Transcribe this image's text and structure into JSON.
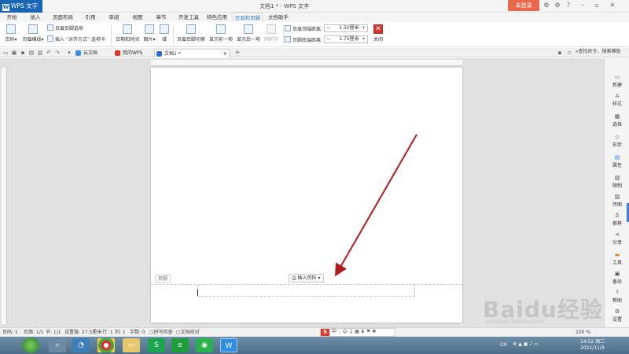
{
  "app": {
    "name": "WPS 文字",
    "doc_title": "文档1 * - WPS 文字",
    "login": "未登录"
  },
  "menu_tabs": [
    "开始",
    "插入",
    "页面布局",
    "引用",
    "审阅",
    "视图",
    "章节",
    "开发工具",
    "特色应用",
    "页眉和页脚",
    "文档助手"
  ],
  "active_menu_tab": 9,
  "ribbon": {
    "page_num": "页码",
    "header_line": "页眉横线",
    "hf_options": "页眉页脚选项",
    "insert_align_tab": "插入 “对齐方式” 选项卡",
    "date_time": "日期和时间",
    "picture": "图片",
    "field": "域",
    "hf_switch": "页眉页脚切换",
    "show_prev": "显示前一项",
    "show_next": "显示后一项",
    "same_prev": "同前节",
    "header_top_label": "页眉顶端距离:",
    "header_top_value": "1.50厘米",
    "footer_bottom_label": "页脚底端距离:",
    "footer_bottom_value": "1.75厘米",
    "close": "关闭",
    "minus": "−",
    "plus": "+"
  },
  "doc_tabs": [
    "云文档",
    "我的WPS",
    "文档1 *"
  ],
  "search_hint": "查找命令、搜索模板",
  "page": {
    "footer_label": "页脚",
    "insert_page_number": "插入页码"
  },
  "right_panel": [
    "新建",
    "样式",
    "选择",
    "形状",
    "属性",
    "限制",
    "传图",
    "推荐",
    "分享",
    "工具",
    "备份",
    "帮助",
    "设置"
  ],
  "status": {
    "page_num": "页码: 1",
    "pages": "页面: 1/1",
    "section": "节: 1/1",
    "setting": "设置值: 27.5厘米",
    "row": "行: 1",
    "col": "列: 1",
    "words": "字数: 0",
    "spell": "拼写检查",
    "proof": "文档校对",
    "zoom": "100 %"
  },
  "taskbar": {
    "time": "14:52 周二",
    "date": "2021/11/9",
    "ch": "CH"
  },
  "watermark": {
    "main": "Baidu经验",
    "sub": "jingyan.baidu.com"
  },
  "colors": {
    "accent": "#2d6fc7",
    "login": "#e8694a",
    "arrow": "#b01b1b"
  }
}
